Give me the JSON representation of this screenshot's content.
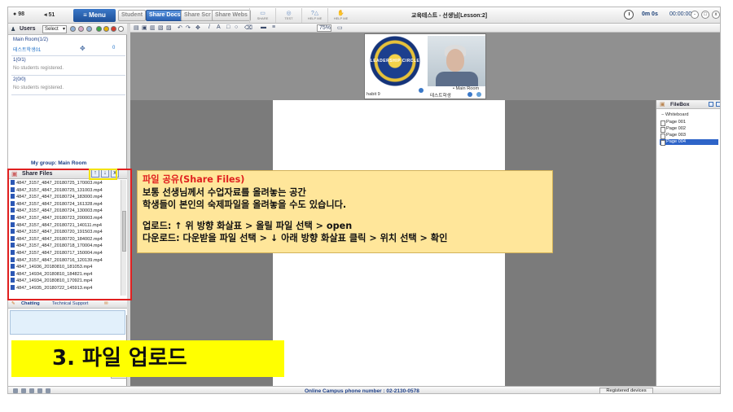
{
  "topbar": {
    "stat_a": "98",
    "stat_b": "51",
    "menu_label": "Menu",
    "tabs": [
      {
        "label": "Student",
        "active": false
      },
      {
        "label": "Share Docs",
        "active": true
      },
      {
        "label": "Share Scr",
        "active": false
      },
      {
        "label": "Share Webs",
        "active": false
      }
    ],
    "mini_labels": [
      "SHARE",
      "TEST",
      "HELP ME",
      "HELP ME"
    ],
    "session_title": "교육테스트 - 선생님[Lesson:2]",
    "elapsed": "0m 0s",
    "clock_time": "00:00:00",
    "window_buttons": [
      "-",
      "□",
      "x"
    ]
  },
  "users": {
    "label": "Users",
    "select_value": "Select",
    "status_colors": [
      "#3aa843",
      "#e9b100",
      "#d93a2b",
      "#ffffff"
    ]
  },
  "rooms": [
    {
      "name": "Main Room(1/2)",
      "member": "테스트학생01",
      "count": "0"
    },
    {
      "name": "1(0/1)",
      "empty": "No students registered."
    },
    {
      "name": "2(0/0)",
      "empty": "No students registered."
    }
  ],
  "my_group": "My group: Main Room",
  "share_files": {
    "label": "Share Files",
    "buttons": [
      "↑",
      "↓",
      "x"
    ],
    "files": [
      "4847_3157_4847_20180725_170003.mp4",
      "4847_3157_4847_20180725_131003.mp4",
      "4847_3157_4847_20180724_183000.mp4",
      "4847_3157_4847_20180724_161328.mp4",
      "4847_3157_4847_20180724_130003.mp4",
      "4847_3157_4847_20180723_200003.mp4",
      "4847_3157_4847_20180721_140111.mp4",
      "4847_3157_4847_20180720_191503.mp4",
      "4847_3157_4847_20180720_184002.mp4",
      "4847_3157_4847_20180718_170004.mp4",
      "4847_3157_4847_20180717_150004.mp4",
      "4847_3157_4847_20180716_120139.mp4",
      "4847_14936_20180810_181053.mp4",
      "4847_14934_20180810_184821.mp4",
      "4847_14934_20180810_170921.mp4",
      "4847_14935_20180722_145913.mp4"
    ]
  },
  "chat": {
    "tab_chatting": "Chatting",
    "tab_support": "Technical Support",
    "send": "Send"
  },
  "toolbar": {
    "zoom": "75%"
  },
  "video": {
    "left_name": "habit 9",
    "right_name": "테스트학생",
    "overlay_label": "Main Room",
    "logo_text": "LEADERSHIP CIRCLE HABIT 9"
  },
  "filebox": {
    "label": "FileBox",
    "whiteboard": "Whiteboard",
    "pages": [
      "Page 001",
      "Page 002",
      "Page 003",
      "Page 004"
    ],
    "selected_index": 3
  },
  "status_bar": {
    "phone": "Online Campus phone number : 02-2130-0578",
    "registered_devices": "Registered devices"
  },
  "callout": {
    "title": "파일 공유(Share Files)",
    "line1": "보통 선생님께서 수업자료를 올려놓는 공간",
    "line2": "학생들이 본인의 숙제파일을 올려놓을 수도 있습니다.",
    "line3": "업로드: ↑ 위 방향 화살표  >  올릴 파일 선택 > open",
    "line4": "다운로드: 다운받을 파일 선택 > ↓ 아래 방향 화살표  클릭 > 위치 선택  >  확인"
  },
  "big_label": "3. 파일 업로드",
  "colors": {
    "annotation_red": "#e02020",
    "annotation_yellow": "#f3e300",
    "callout_bg": "#ffe69a",
    "label_bg": "#ffff00",
    "menu_blue": "#1d4f97"
  }
}
